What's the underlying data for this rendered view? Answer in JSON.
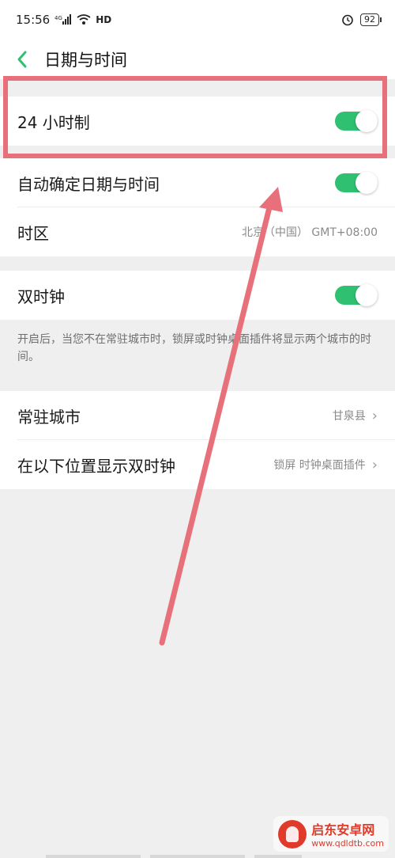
{
  "status_bar": {
    "time": "15:56",
    "network": "4G",
    "hd": "HD",
    "battery": "92"
  },
  "header": {
    "title": "日期与时间"
  },
  "rows": {
    "hour24": {
      "label": "24 小时制",
      "toggle_on": true
    },
    "auto_datetime": {
      "label": "自动确定日期与时间",
      "toggle_on": true
    },
    "timezone": {
      "label": "时区",
      "value": "北京（中国） GMT+08:00"
    },
    "dual_clock": {
      "label": "双时钟",
      "toggle_on": true
    },
    "home_city": {
      "label": "常驻城市",
      "value": "甘泉县"
    },
    "dual_clock_location": {
      "label": "在以下位置显示双时钟",
      "value": "锁屏 时钟桌面插件"
    }
  },
  "dual_clock_note": "开启后，当您不在常驻城市时，锁屏或时钟桌面插件将显示两个城市的时间。",
  "watermark": {
    "title": "启东安卓网",
    "url": "www.qdldtb.com"
  },
  "colors": {
    "toggle_on": "#2fc071",
    "accent_back": "#2fc071",
    "highlight": "#e8707a"
  },
  "icons": {
    "back": "chevron-left-icon",
    "signal": "signal-icon",
    "wifi": "wifi-icon",
    "alarm": "alarm-icon",
    "chevron": "chevron-right-icon"
  }
}
